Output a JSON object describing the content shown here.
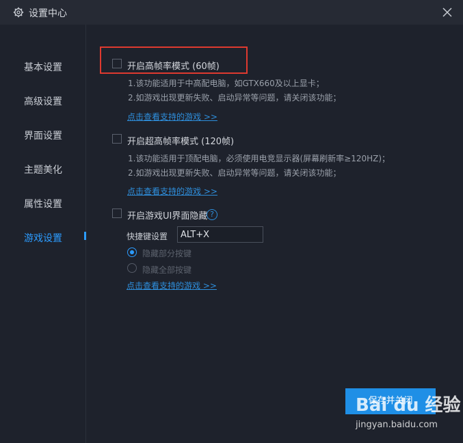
{
  "window": {
    "title": "设置中心",
    "icons": {
      "title": "gear-icon",
      "close": "close-icon"
    }
  },
  "sidebar": {
    "items": [
      {
        "label": "基本设置",
        "active": false
      },
      {
        "label": "高级设置",
        "active": false
      },
      {
        "label": "界面设置",
        "active": false
      },
      {
        "label": "主题美化",
        "active": false
      },
      {
        "label": "属性设置",
        "active": false
      },
      {
        "label": "游戏设置",
        "active": true
      }
    ]
  },
  "options": {
    "high_fps": {
      "label": "开启高帧率模式 (60帧)",
      "checked": false,
      "desc1": "1.该功能适用于中高配电脑，如GTX660及以上显卡；",
      "desc2": "2.如游戏出现更新失败、启动异常等问题，请关闭该功能；",
      "link": "点击查看支持的游戏 >>"
    },
    "ultra_fps": {
      "label": "开启超高帧率模式 (120帧)",
      "checked": false,
      "desc1": "1.该功能适用于顶配电脑，必须使用电竞显示器(屏幕刷新率≥120HZ)；",
      "desc2": "2.如游戏出现更新失败、启动异常等问题，请关闭该功能；",
      "link": "点击查看支持的游戏 >>"
    },
    "hide_ui": {
      "label": "开启游戏UI界面隐藏",
      "checked": false,
      "help": "?",
      "hotkey_label": "快捷键设置",
      "hotkey_value": "ALT+X",
      "radio1": "隐藏部分按键",
      "radio1_checked": true,
      "radio2": "隐藏全部按键",
      "radio2_checked": false,
      "link": "点击查看支持的游戏 >>"
    }
  },
  "footer": {
    "save_label": "保存并关闭"
  },
  "watermark": {
    "brand": "Bai du 经验",
    "url": "jingyan.baidu.com"
  },
  "colors": {
    "accent": "#2c9cff",
    "highlight": "#e03a2f",
    "background": "#1e222c"
  }
}
